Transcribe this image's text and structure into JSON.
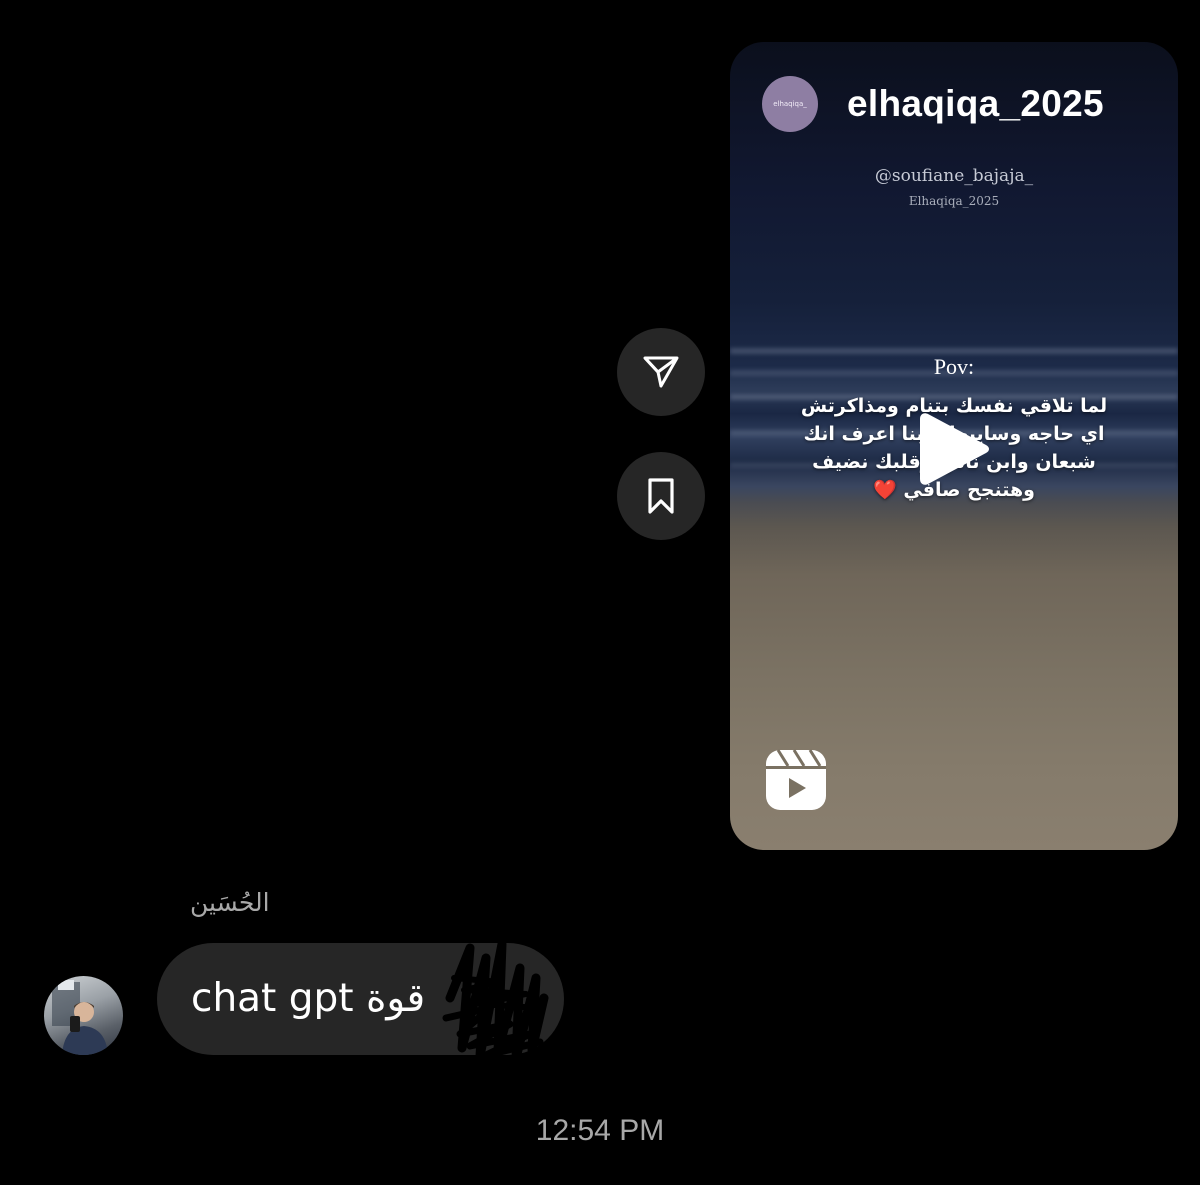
{
  "reel": {
    "username": "elhaqiqa_2025",
    "avatar_text": "elhaqiqa_",
    "overlay_handle": "@soufiane_bajaja_",
    "overlay_watermark": "Elhaqiqa_2025",
    "overlay_pov": "Pov:",
    "caption_lines": [
      "لما تلاقي نفسك بتنام ومذاكرتش",
      "اي حاجه وسايبها لربنا اعرف انك",
      "شبعان وابن ناس وقلبك نضيف",
      "وهتنجح صافي"
    ],
    "caption_emoji": "❤️",
    "play_icon": "play-icon",
    "type_icon": "reels-icon"
  },
  "actions": {
    "share_icon": "paper-plane-icon",
    "save_icon": "bookmark-icon"
  },
  "message": {
    "sender_name": "الحُسَين",
    "text": "chat gpt قوة"
  },
  "timestamp": "12:54 PM",
  "colors": {
    "background": "#000000",
    "bubble": "#262626",
    "secondary_text": "#a8a8a8",
    "heart": "#e3262c"
  }
}
